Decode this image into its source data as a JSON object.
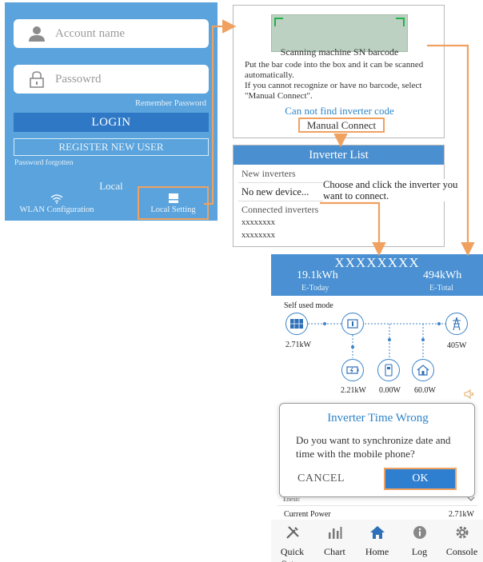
{
  "login": {
    "account_placeholder": "Account name",
    "password_placeholder": "Passowrd",
    "remember_label": "Remember Password",
    "login_button": "LOGIN",
    "register_button": "REGISTER NEW USER",
    "forgot_link": "Password forgotten",
    "local_heading": "Local",
    "wlan_label": "WLAN Configuration",
    "local_setting_label": "Local Setting"
  },
  "scan": {
    "title": "Scanning machine SN barcode",
    "instructions_1": "Put the bar code into the box and it can be scanned automatically.",
    "instructions_2": "If you cannot recognize or have no barcode, select \"Manual Connect\".",
    "not_find_link": "Can not find inverter code",
    "manual_connect": "Manual Connect"
  },
  "inverter_list": {
    "header": "Inverter List",
    "new_inverters_label": "New inverters",
    "no_new_device": "No new device...",
    "connected_label": "Connected inverters",
    "connected_items": [
      "xxxxxxxx",
      "xxxxxxxx"
    ],
    "annotation": "Choose and click the inverter you want to connect."
  },
  "app": {
    "device_name": "XXXXXXXX",
    "e_today_value": "19.1kWh",
    "e_today_label": "E-Today",
    "e_total_value": "494kWh",
    "e_total_label": "E-Total",
    "mode_label": "Self used mode",
    "pv_power": "2.71kW",
    "grid_power": "405W",
    "battery_power": "2.21kW",
    "meter_power": "0.00W",
    "home_power": "60.0W",
    "partial_label": "Enesic",
    "current_power_label": "Current Power",
    "current_power_value": "2.71kW"
  },
  "dialog": {
    "title": "Inverter Time Wrong",
    "message": "Do you want to synchronize date and time with the mobile phone?",
    "cancel": "CANCEL",
    "ok": "OK"
  },
  "nav": [
    {
      "label": "Quick Setup",
      "icon": "tools-icon"
    },
    {
      "label": "Chart",
      "icon": "bar-chart-icon"
    },
    {
      "label": "Home",
      "icon": "home-icon"
    },
    {
      "label": "Log",
      "icon": "info-icon"
    },
    {
      "label": "Console",
      "icon": "gear-icon"
    }
  ],
  "colors": {
    "login_bg": "#5aa3dc",
    "primary_blue": "#4a90d2",
    "highlight_orange": "#f0a15f",
    "home_active": "#2d6fb8"
  }
}
